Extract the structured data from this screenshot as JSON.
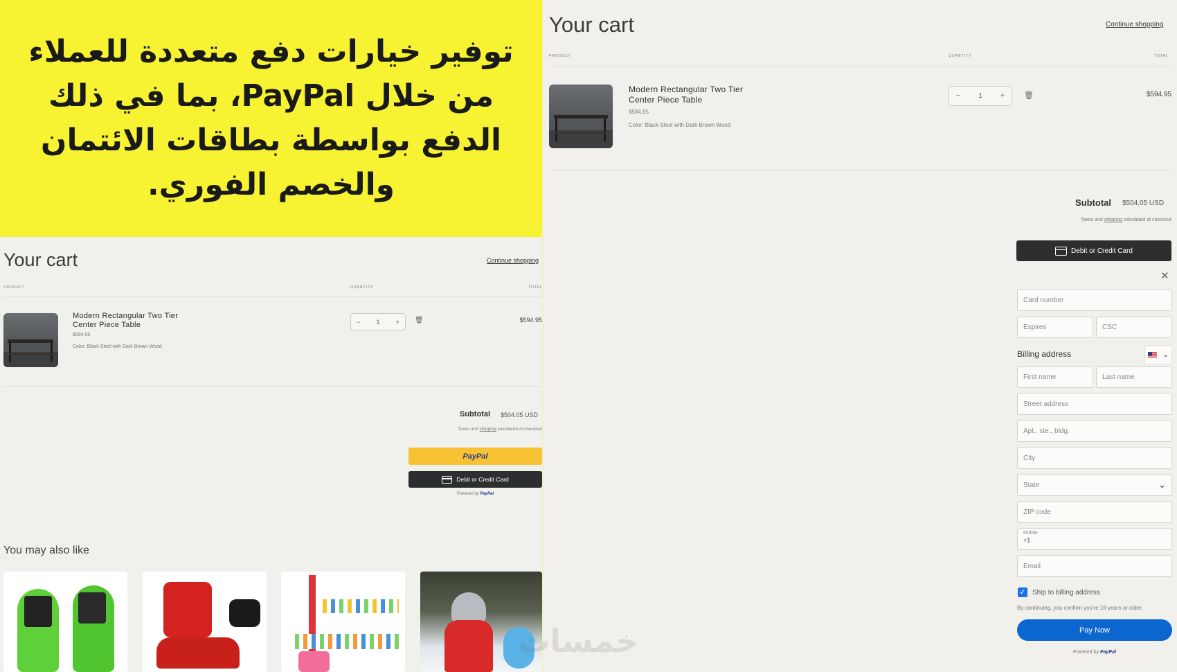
{
  "banner": {
    "text": "توفير خيارات دفع متعددة للعملاء من خلال PayPal، بما في ذلك الدفع بواسطة بطاقات الائتمان والخصم الفوري."
  },
  "left_cart": {
    "title": "Your cart",
    "continue_shopping": "Continue shopping",
    "columns": {
      "product": "PRODUCT",
      "quantity": "QUANTITY",
      "total": "TOTAL"
    },
    "item": {
      "name_line1": "Modern Rectangular Two Tier",
      "name_line2": "Center Piece Table",
      "price": "$594.95",
      "variant": "Color: Black Steel with Dark Brown Wood",
      "qty_minus": "−",
      "quantity": "1",
      "qty_plus": "+",
      "delete_icon": "🗑",
      "line_total": "$594.95"
    },
    "subtotal_label": "Subtotal",
    "subtotal_value": "$504.05 USD",
    "tax_prefix": "Taxes and ",
    "tax_link": "shipping",
    "tax_suffix": " calculated at checkout",
    "paypal_button": "PayPal",
    "card_button": "Debit or Credit Card",
    "powered_prefix": "Powered by ",
    "powered_brand": "PayPal",
    "also_like": "You may also like"
  },
  "right_cart": {
    "title": "Your cart",
    "continue_shopping": "Continue shopping",
    "columns": {
      "product": "PRODUCT",
      "quantity": "QUANTITY",
      "total": "TOTAL"
    },
    "item": {
      "name_line1": "Modern Rectangular Two Tier",
      "name_line2": "Center Piece Table",
      "price": "$594.95",
      "variant": "Color: Black Steel with Dark Brown Wood",
      "qty_minus": "−",
      "quantity": "1",
      "qty_plus": "+",
      "delete_icon": "🗑",
      "line_total": "$594.95"
    },
    "subtotal_label": "Subtotal",
    "subtotal_value": "$504.05 USD",
    "tax_prefix": "Taxes and ",
    "tax_link": "shipping",
    "tax_suffix": " calculated at checkout",
    "card_button": "Debit or Credit Card",
    "close_icon": "✕",
    "form": {
      "card_number": "Card number",
      "expires": "Expires",
      "csc": "CSC",
      "billing_address": "Billing address",
      "first_name": "First name",
      "last_name": "Last name",
      "street": "Street address",
      "apt": "Apt., ste., bldg.",
      "city": "City",
      "state": "State",
      "zip": "ZIP code",
      "mobile_label": "Mobile",
      "mobile_value": "+1",
      "email": "Email",
      "ship_to_billing": "Ship to billing address",
      "consent": "By continuing, you confirm you're 18 years or older.",
      "pay_now": "Pay Now",
      "check_mark": "✓",
      "chevron": "⌄"
    },
    "powered_prefix": "Powered by ",
    "powered_brand": "PayPal"
  },
  "watermark": "خمسات",
  "colors": {
    "banner": "#f7f332",
    "paypal_yellow": "#f9c235",
    "pay_blue": "#0c66d0",
    "dark_button": "#2c2e2f"
  }
}
